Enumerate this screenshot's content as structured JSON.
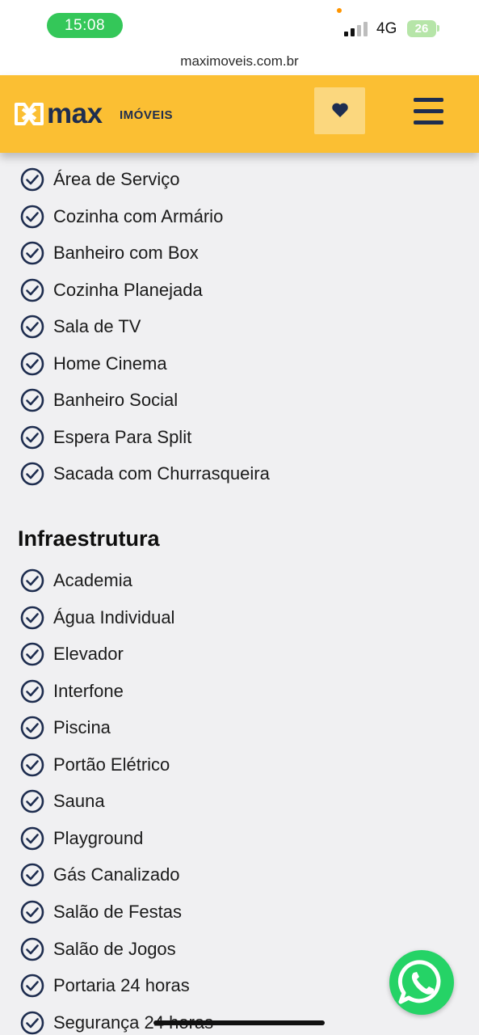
{
  "status_bar": {
    "time": "15:08",
    "network": "4G",
    "battery": "26"
  },
  "browser": {
    "url": "maximoveis.com.br"
  },
  "header": {
    "logo_primary": "max",
    "logo_secondary": "IMÓVEIS",
    "favorites_icon": "heart-icon",
    "menu_icon": "hamburger-menu-icon",
    "brand_color": "#fbbf33",
    "navy_color": "#1e2d4f"
  },
  "features": {
    "items": [
      "Área de Serviço",
      "Cozinha com Armário",
      "Banheiro com Box",
      "Cozinha Planejada",
      "Sala de TV",
      "Home Cinema",
      "Banheiro Social",
      "Espera Para Split",
      "Sacada com Churrasqueira"
    ]
  },
  "infrastructure": {
    "title": "Infraestrutura",
    "items": [
      "Academia",
      "Água Individual",
      "Elevador",
      "Interfone",
      "Piscina",
      "Portão Elétrico",
      "Sauna",
      "Playground",
      "Gás Canalizado",
      "Salão de Festas",
      "Salão de Jogos",
      "Portaria 24 horas",
      "Segurança 24 horas"
    ]
  },
  "floating": {
    "whatsapp_icon": "whatsapp-icon"
  }
}
